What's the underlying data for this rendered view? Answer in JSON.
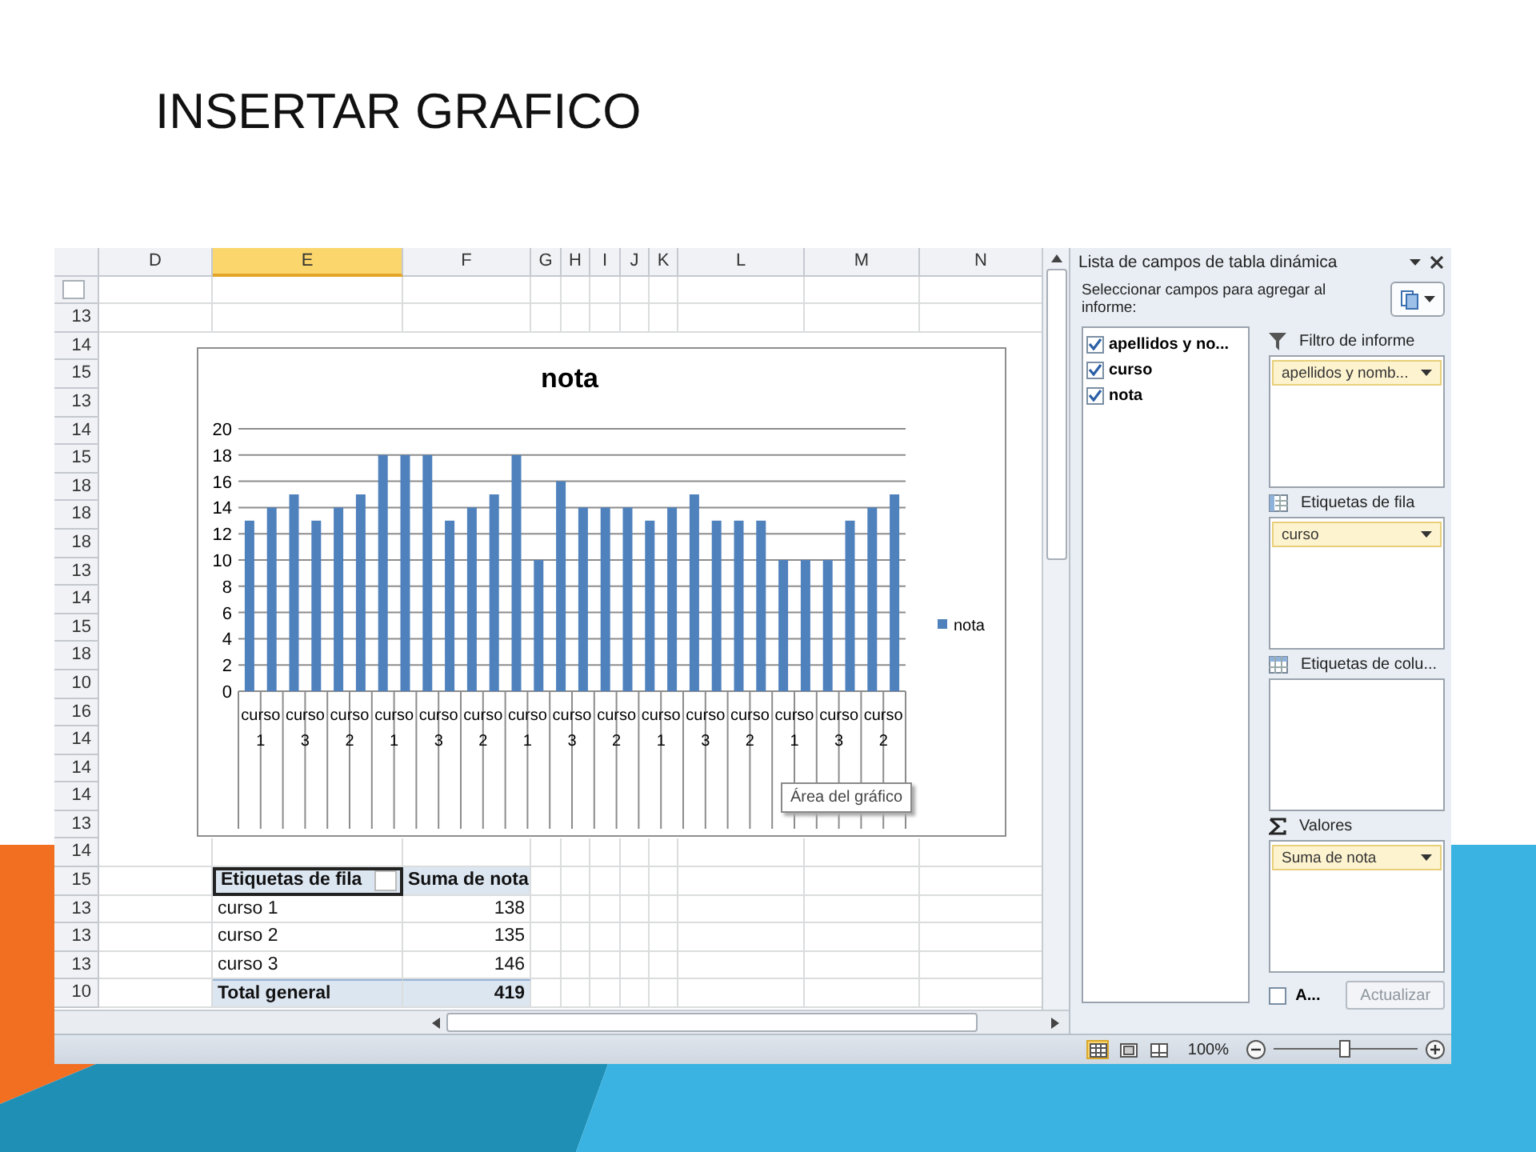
{
  "slide_title": "INSERTAR GRAFICO",
  "sheet": {
    "columns": [
      {
        "label": "D",
        "selected": false
      },
      {
        "label": "E",
        "selected": true
      },
      {
        "label": "F",
        "selected": false
      },
      {
        "label": "G",
        "selected": false
      },
      {
        "label": "H",
        "selected": false
      },
      {
        "label": "I",
        "selected": false
      },
      {
        "label": "J",
        "selected": false
      },
      {
        "label": "K",
        "selected": false
      },
      {
        "label": "L",
        "selected": false
      },
      {
        "label": "M",
        "selected": false
      },
      {
        "label": "N",
        "selected": false
      }
    ],
    "rows": [
      "13",
      "14",
      "15",
      "13",
      "14",
      "15",
      "18",
      "18",
      "18",
      "13",
      "14",
      "15",
      "18",
      "10",
      "16",
      "14",
      "14",
      "14",
      "13",
      "14",
      "15",
      "13",
      "13",
      "13",
      "10"
    ]
  },
  "pivot_table": {
    "columns": [
      "Etiquetas de fila",
      "Suma de nota"
    ],
    "rows": [
      {
        "label": "curso 1",
        "value": "138"
      },
      {
        "label": "curso 2",
        "value": "135"
      },
      {
        "label": "curso 3",
        "value": "146"
      }
    ],
    "total": {
      "label": "Total general",
      "value": "419"
    }
  },
  "chart": {
    "chart_data": {
      "type": "bar",
      "title": "nota",
      "grid": true,
      "ylim": [
        0,
        20
      ],
      "yticks": [
        0,
        2,
        4,
        6,
        8,
        10,
        12,
        14,
        16,
        18,
        20
      ],
      "series": [
        {
          "name": "nota",
          "color": "#4f81bd",
          "values": [
            13,
            14,
            15,
            13,
            14,
            15,
            18,
            18,
            18,
            13,
            14,
            15,
            18,
            10,
            16,
            14,
            14,
            14,
            13,
            14,
            15,
            13,
            13,
            13,
            10,
            10,
            10,
            13,
            14,
            15
          ]
        }
      ]
    },
    "category_groups": [
      "curso 1",
      "curso 3",
      "curso 2",
      "curso 1",
      "curso 3",
      "curso 2",
      "curso 1",
      "curso 3",
      "curso 2",
      "curso 1",
      "curso 3",
      "curso 2",
      "curso 1",
      "curso 3",
      "curso 2"
    ],
    "tooltip": "Área del gráfico"
  },
  "field_list": {
    "title": "Lista de campos de tabla dinámica",
    "instruction": "Seleccionar campos para agregar al informe:",
    "fields": [
      {
        "label": "apellidos y no...",
        "checked": true
      },
      {
        "label": "curso",
        "checked": true
      },
      {
        "label": "nota",
        "checked": true
      }
    ],
    "areas": [
      {
        "kind": "filter",
        "label": "Filtro de informe",
        "chips": [
          "apellidos y nomb..."
        ]
      },
      {
        "kind": "rows",
        "label": "Etiquetas de fila",
        "chips": [
          "curso"
        ]
      },
      {
        "kind": "columns",
        "label": "Etiquetas de colu..."
      },
      {
        "kind": "values",
        "label": "Valores",
        "chips": [
          "Suma de nota"
        ]
      }
    ],
    "defer": {
      "label": "A...",
      "checked": false
    },
    "update_button": {
      "label": "Actualizar",
      "disabled": true
    }
  },
  "status_bar": {
    "views": [
      {
        "kind": "normal",
        "selected": true
      },
      {
        "kind": "layout",
        "selected": false
      },
      {
        "kind": "pagebreak",
        "selected": false
      }
    ],
    "zoom": "100%",
    "zoom_slider": {
      "level": 0.5
    }
  }
}
